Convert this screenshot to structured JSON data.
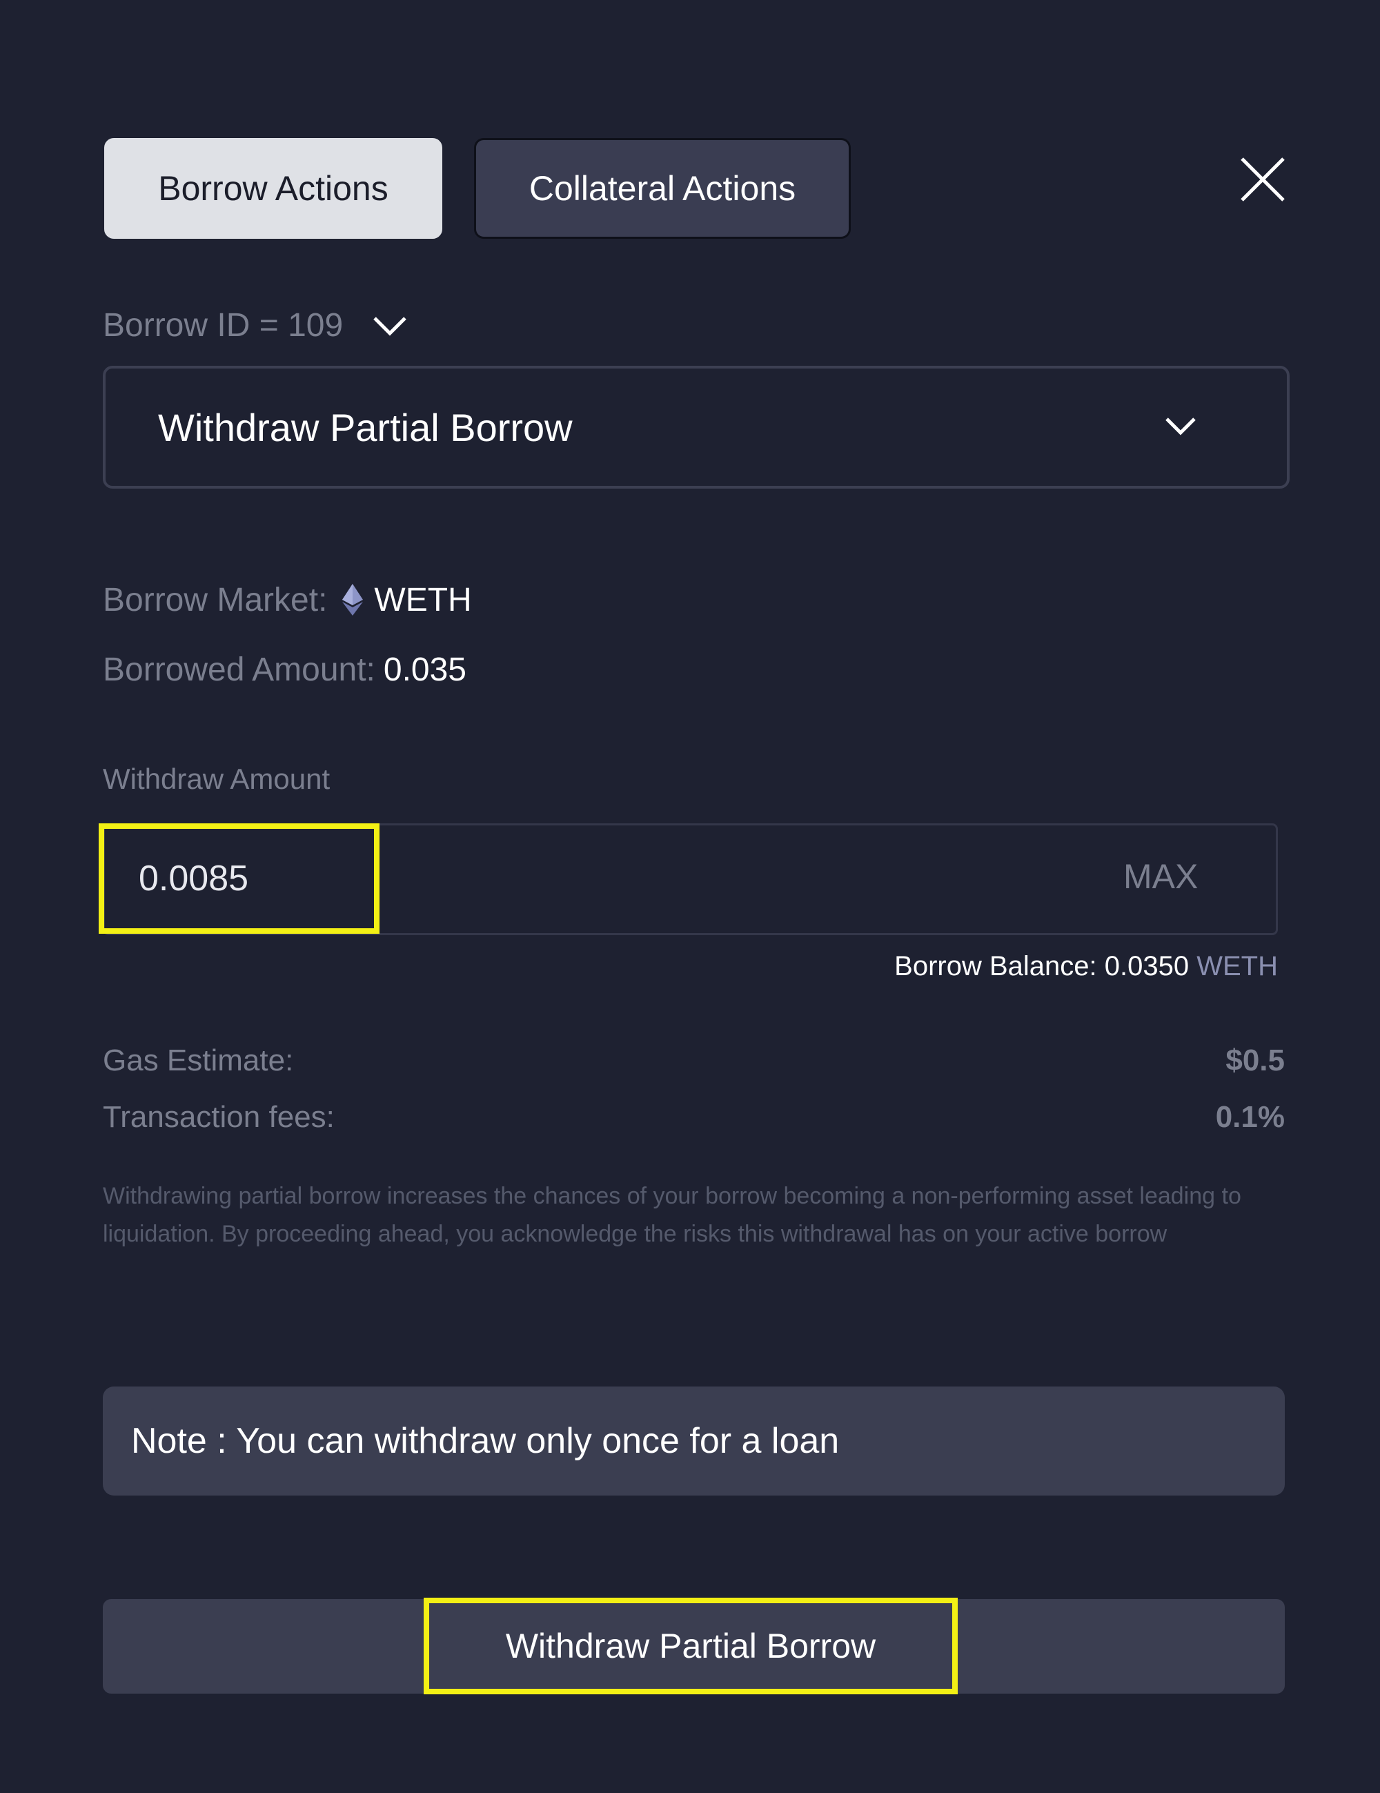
{
  "tabs": {
    "borrow_actions": "Borrow Actions",
    "collateral_actions": "Collateral Actions"
  },
  "borrow_id": {
    "label": "Borrow ID = 109"
  },
  "action_select": {
    "selected": "Withdraw Partial Borrow"
  },
  "info": {
    "borrow_market_label": "Borrow Market:",
    "borrow_market_value": "WETH",
    "borrowed_amount_label": "Borrowed Amount:",
    "borrowed_amount_value": "0.035"
  },
  "withdraw": {
    "label": "Withdraw Amount",
    "value": "0.0085",
    "max_label": "MAX",
    "balance_text": "Borrow Balance: 0.0350",
    "balance_unit": "WETH"
  },
  "fees": {
    "gas_label": "Gas Estimate:",
    "gas_value": "$0.5",
    "tx_label": "Transaction fees:",
    "tx_value": "0.1%"
  },
  "disclaimer": "Withdrawing partial borrow increases the chances of your borrow becoming a non-performing asset leading to liquidation. By proceeding ahead, you acknowledge the risks this withdrawal has on your active borrow",
  "note": "Note : You can withdraw only once for a loan",
  "submit": {
    "label": "Withdraw Partial Borrow"
  },
  "icons": {
    "close": "close-icon",
    "chevron": "chevron-down-icon",
    "eth": "ethereum-icon"
  },
  "colors": {
    "background": "#1e2131",
    "highlight": "#f3f015",
    "panel": "#3b3e51",
    "muted_text": "#7b7f8f"
  }
}
